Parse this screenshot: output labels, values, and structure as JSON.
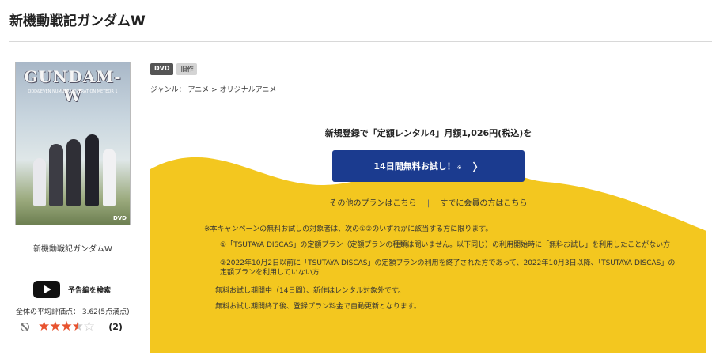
{
  "page": {
    "title": "新機動戦記ガンダムW"
  },
  "cover": {
    "title_art": "GUNDAM-W",
    "subtitle_art": "ODD&EVEN NUMBERS OPERATION METEOR 1",
    "dvd_mark": "DVD"
  },
  "item": {
    "name": "新機動戦記ガンダムW",
    "trailer_label": "予告編を検索",
    "average_rating": "全体の平均評価点： 3.62(5点満点)",
    "rating_value": 3.62,
    "review_count": "(2)"
  },
  "badges": [
    "DVD",
    "旧作"
  ],
  "genre": {
    "label": "ジャンル：",
    "items": [
      "アニメ",
      "オリジナルアニメ"
    ],
    "separator": ">"
  },
  "campaign": {
    "headline": "新規登録で「定額レンタル4」月額1,026円(税込)を",
    "cta_label": "14日間無料お試し！",
    "cta_note": "※",
    "other_plans": "その他のプランはこちら",
    "member_login": "すでに会員の方はこちら",
    "notes": [
      "※本キャンペーンの無料お試しの対象者は、次の①②のいずれかに該当する方に限ります。",
      "①「TSUTAYA DISCAS」の定額プラン（定額プランの種類は問いません。以下同じ）の利用開始時に「無料お試し」を利用したことがない方",
      "②2022年10月2日以前に「TSUTAYA DISCAS」の定額プランの利用を終了された方であって、2022年10月3日以降、「TSUTAYA DISCAS」の定額プランを利用していない方",
      "無料お試し期間中（14日間）、新作はレンタル対象外です。",
      "無料お試し期間終了後、登録プラン料金で自動更新となります。"
    ]
  },
  "colors": {
    "accent_yellow": "#f3c71f",
    "cta_blue": "#1b3b8f",
    "star": "#e8532f"
  }
}
